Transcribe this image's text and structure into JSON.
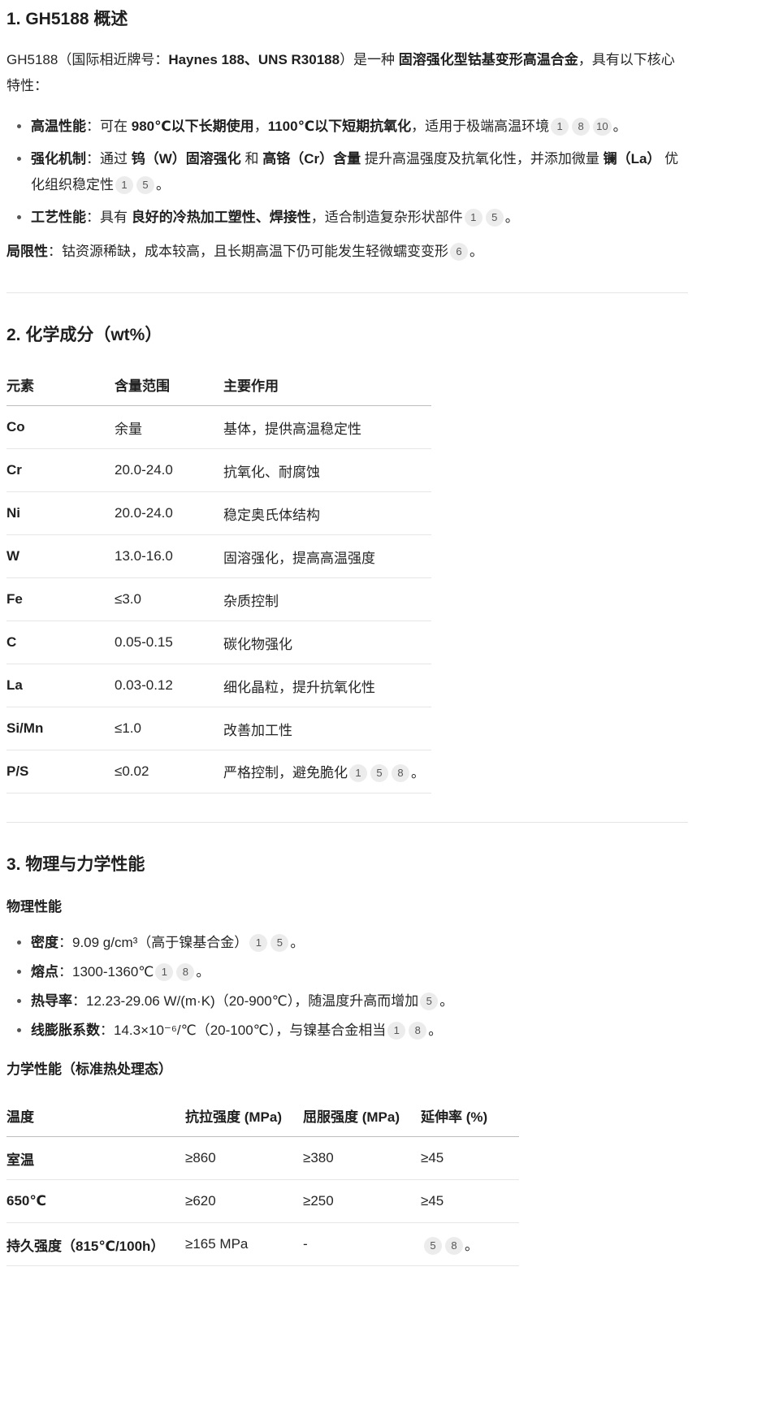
{
  "s1": {
    "title": "1. GH5188 概述",
    "intro": {
      "t1": "GH5188（国际相近牌号：",
      "b1": "Haynes 188、UNS R30188",
      "t2": "）是一种 ",
      "b2": "固溶强化型钴基变形高温合金",
      "t3": "，具有以下核心特性："
    },
    "items": [
      {
        "label": "高温性能",
        "t1": "：可在 ",
        "b1": "980℃以下长期使用",
        "t2": "，",
        "b2": "1100℃以下短期抗氧化",
        "t3": "，适用于极端高温环境",
        "cites": [
          "1",
          "8",
          "10"
        ],
        "end": "。"
      },
      {
        "label": "强化机制",
        "t1": "：通过 ",
        "b1": "钨（W）固溶强化",
        "t2": " 和 ",
        "b2": "高铬（Cr）含量",
        "t3": " 提升高温强度及抗氧化性，并添加微量 ",
        "b3": "镧（La）",
        "t4": " 优化组织稳定性",
        "cites": [
          "1",
          "5"
        ],
        "end": "。"
      },
      {
        "label": "工艺性能",
        "t1": "：具有 ",
        "b1": "良好的冷热加工塑性、焊接性",
        "t2": "，适合制造复杂形状部件",
        "cites": [
          "1",
          "5"
        ],
        "end": "。"
      }
    ],
    "limit": {
      "label": "局限性",
      "text": "：钴资源稀缺，成本较高，且长期高温下仍可能发生轻微蠕变变形",
      "cites": [
        "6"
      ],
      "end": "。"
    }
  },
  "s2": {
    "title": "2. 化学成分（wt%）",
    "headers": [
      "元素",
      "含量范围",
      "主要作用"
    ],
    "rows": [
      [
        "Co",
        "余量",
        "基体，提供高温稳定性"
      ],
      [
        "Cr",
        "20.0-24.0",
        "抗氧化、耐腐蚀"
      ],
      [
        "Ni",
        "20.0-24.0",
        "稳定奥氏体结构"
      ],
      [
        "W",
        "13.0-16.0",
        "固溶强化，提高高温强度"
      ],
      [
        "Fe",
        "≤3.0",
        "杂质控制"
      ],
      [
        "C",
        "0.05-0.15",
        "碳化物强化"
      ],
      [
        "La",
        "0.03-0.12",
        "细化晶粒，提升抗氧化性"
      ],
      [
        "Si/Mn",
        "≤1.0",
        "改善加工性"
      ],
      [
        "P/S",
        "≤0.02",
        "严格控制，避免脆化"
      ]
    ],
    "last_cites": [
      "1",
      "5",
      "8"
    ],
    "last_end": "。"
  },
  "s3": {
    "title": "3. 物理与力学性能",
    "phys_title": "物理性能",
    "phys": [
      {
        "label": "密度",
        "text": "：9.09 g/cm³（高于镍基合金）",
        "cites": [
          "1",
          "5"
        ],
        "end": "。"
      },
      {
        "label": "熔点",
        "text": "：1300-1360℃",
        "cites": [
          "1",
          "8"
        ],
        "end": "。"
      },
      {
        "label": "热导率",
        "text": "：12.23-29.06 W/(m·K)（20-900℃），随温度升高而增加",
        "cites": [
          "5"
        ],
        "end": "。"
      },
      {
        "label": "线膨胀系数",
        "text": "：14.3×10⁻⁶/℃（20-100℃），与镍基合金相当",
        "cites": [
          "1",
          "8"
        ],
        "end": "。"
      }
    ],
    "mech_title": "力学性能（标准热处理态）",
    "mech_headers": [
      "温度",
      "抗拉强度 (MPa)",
      "屈服强度 (MPa)",
      "延伸率 (%)"
    ],
    "mech_rows": [
      [
        "室温",
        "≥860",
        "≥380",
        "≥45"
      ],
      [
        "650℃",
        "≥620",
        "≥250",
        "≥45"
      ],
      [
        "持久强度（815℃/100h）",
        "≥165 MPa",
        "-",
        ""
      ]
    ],
    "mech_last_cites": [
      "5",
      "8"
    ],
    "mech_last_end": "。"
  }
}
